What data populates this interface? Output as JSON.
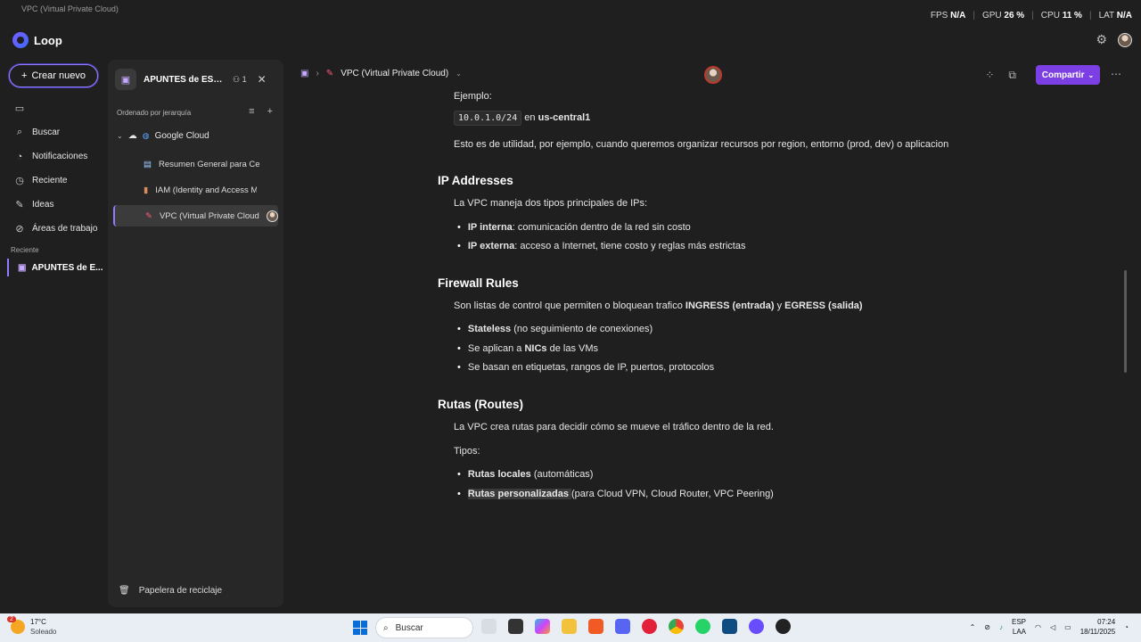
{
  "window": {
    "title": "VPC (Virtual Private Cloud)"
  },
  "perf": {
    "fps_label": "FPS",
    "fps_value": "N/A",
    "gpu_label": "GPU",
    "gpu_value": "26 %",
    "cpu_label": "CPU",
    "cpu_value": "11 %",
    "lat_label": "LAT",
    "lat_value": "N/A"
  },
  "app": {
    "name": "Loop"
  },
  "nav": {
    "new_button": "Crear nuevo",
    "items": [
      "",
      "Buscar",
      "Notificaciones",
      "Reciente",
      "Ideas",
      "Áreas de trabajo"
    ],
    "recent_header": "Reciente",
    "recent_item": "APUNTES de E..."
  },
  "workspace": {
    "name": "APUNTES de ESTUDIO",
    "members": "1",
    "sort_label": "Ordenado por jerarquía",
    "root": "Google Cloud",
    "pages": [
      "Resumen General para Certificación",
      "IAM (Identity and Access Management)",
      "VPC (Virtual Private Cloud)"
    ],
    "trash": "Papelera de reciclaje"
  },
  "docbar": {
    "title": "VPC (Virtual Private Cloud)",
    "share": "Compartir"
  },
  "doc": {
    "example_label": "Ejemplo:",
    "example_code": "10.0.1.0/24",
    "example_in": "en",
    "example_region": "us-central1",
    "utility": "Esto es de utilidad, por ejemplo, cuando queremos organizar recursos por region, entorno (prod, dev) o aplicacion",
    "ip_heading": "IP Addresses",
    "ip_intro": "La VPC maneja dos tipos principales de IPs:",
    "ip_internal_b": "IP interna",
    "ip_internal": ": comunicación dentro de la red sin costo",
    "ip_external_b": "IP externa",
    "ip_external": ": acceso a Internet, tiene costo y reglas más estrictas",
    "fw_heading": "Firewall Rules",
    "fw_intro_a": "Son listas de control que permiten o bloquean trafico ",
    "fw_ingress": "INGRESS (entrada)",
    "fw_and": " y ",
    "fw_egress": "EGRESS (salida)",
    "fw_l1_b": "Stateless",
    "fw_l1": " (no seguimiento de conexiones)",
    "fw_l2_a": "Se aplican a ",
    "fw_l2_b": "NICs",
    "fw_l2_c": " de las VMs",
    "fw_l3": "Se basan en etiquetas, rangos de IP, puertos, protocolos",
    "rt_heading": "Rutas (Routes)",
    "rt_intro": "La VPC crea rutas para decidir cómo se mueve el tráfico dentro de la red.",
    "rt_types": "Tipos:",
    "rt_l1_b": "Rutas locales",
    "rt_l1": " (automáticas)",
    "rt_l2_b": "Rutas personalizadas ",
    "rt_l2": "(para Cloud VPN, Cloud Router, VPC Peering)"
  },
  "taskbar": {
    "temp": "17°C",
    "weather": "Soleado",
    "weather_badge": "2",
    "search": "Buscar",
    "lang1": "ESP",
    "lang2": "LAA",
    "time": "07:24",
    "date": "18/11/2025"
  },
  "colors": {
    "accent": "#7b3fe4",
    "outline": "#8f7dff",
    "background": "#1f1f1f"
  }
}
